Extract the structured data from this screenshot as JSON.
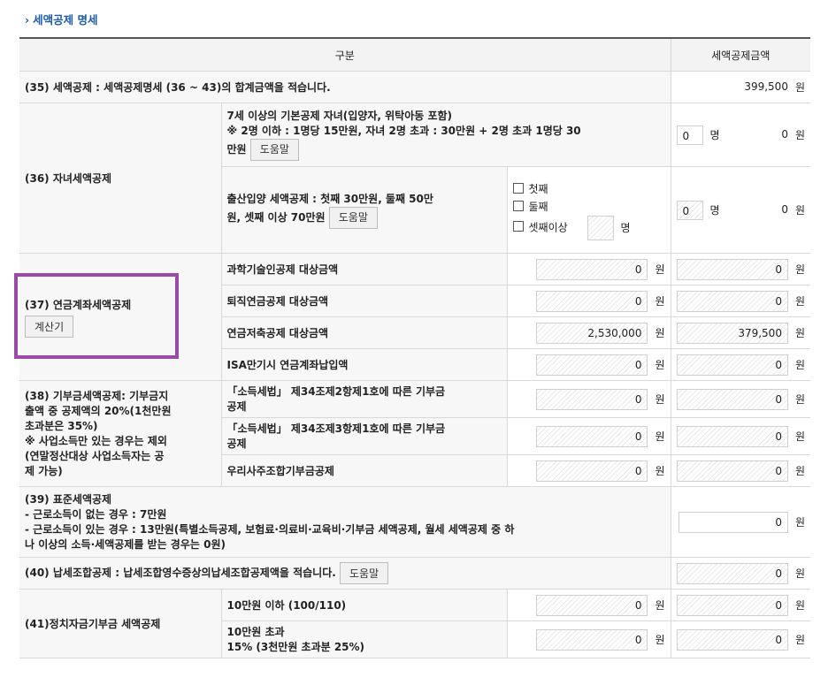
{
  "section_title": "세액공제 명세",
  "header": {
    "col_category": "구분",
    "col_amount": "세액공제금액"
  },
  "unit_won": "원",
  "unit_person": "명",
  "help": "도움말",
  "row35": {
    "label": "(35) 세액공제 : 세액공제명세 (36 ~ 43)의 합계금액을 적습니다.",
    "amount": "399,500"
  },
  "row36": {
    "label": "(36) 자녀세액공제",
    "sub1": {
      "line1": "7세 이상의 기본공제 자녀(입양자, 위탁아동 포함)",
      "line2": "※ 2명 이하 : 1명당 15만원, 자녀 2명 초과 : 30만원 + 2명 초과 1명당 30",
      "line3": "만원",
      "count": "0",
      "amount": "0"
    },
    "sub2": {
      "line1": "출산입양 세액공제 : 첫째 30만원, 둘째 50만",
      "line2": "원, 셋째 이상 70만원",
      "opts": [
        "첫째",
        "둘째",
        "셋째이상"
      ],
      "count": "0",
      "amount": "0"
    }
  },
  "row37": {
    "label": "(37) 연금계좌세액공제",
    "calc": "계산기",
    "items": [
      {
        "label": "과학기술인공제 대상금액",
        "base": "0",
        "amount": "0"
      },
      {
        "label": "퇴직연금공제 대상금액",
        "base": "0",
        "amount": "0"
      },
      {
        "label": "연금저축공제 대상금액",
        "base": "2,530,000",
        "amount": "379,500"
      },
      {
        "label": "ISA만기시 연금계좌납입액",
        "base": "0",
        "amount": "0"
      }
    ]
  },
  "row38": {
    "l1": "(38) 기부금세액공제: 기부금지",
    "l2": "출액 중 공제액의 20%(1천만원",
    "l3": "초과분은 35%)",
    "l4": "※ 사업소득만 있는 경우는 제외",
    "l5": "(연말정산대상 사업소득자는 공",
    "l6": "제 가능)",
    "items": [
      {
        "a": "「소득세법」 제34조제2항제1호에 따른 기부금",
        "b": "공제",
        "base": "0",
        "amount": "0"
      },
      {
        "a": "「소득세법」 제34조제3항제1호에 따른 기부금",
        "b": "공제",
        "base": "0",
        "amount": "0"
      },
      {
        "a": "우리사주조합기부금공제",
        "b": "",
        "base": "0",
        "amount": "0"
      }
    ]
  },
  "row39": {
    "l1": "(39) 표준세액공제",
    "l2": " - 근로소득이 없는 경우 : 7만원",
    "l3": " - 근로소득이 있는 경우 : 13만원(특별소득공제, 보험료·의료비·교육비·기부금 세액공제, 월세 세액공제 중 하",
    "l4": "나 이상의 소득·세액공제를 받는 경우는 0원)",
    "amount": "0"
  },
  "row40": {
    "label": "(40) 납세조합공제 : 납세조합영수증상의납세조합공제액을 적습니다.",
    "amount": "0"
  },
  "row41": {
    "label": "(41)정치자금기부금 세액공제",
    "items": [
      {
        "a": "10만원 이하 (100/110)",
        "b": "",
        "base": "0",
        "amount": "0"
      },
      {
        "a": "10만원 초과",
        "b": "15% (3천만원 초과분 25%)",
        "base": "0",
        "amount": "0"
      }
    ]
  }
}
